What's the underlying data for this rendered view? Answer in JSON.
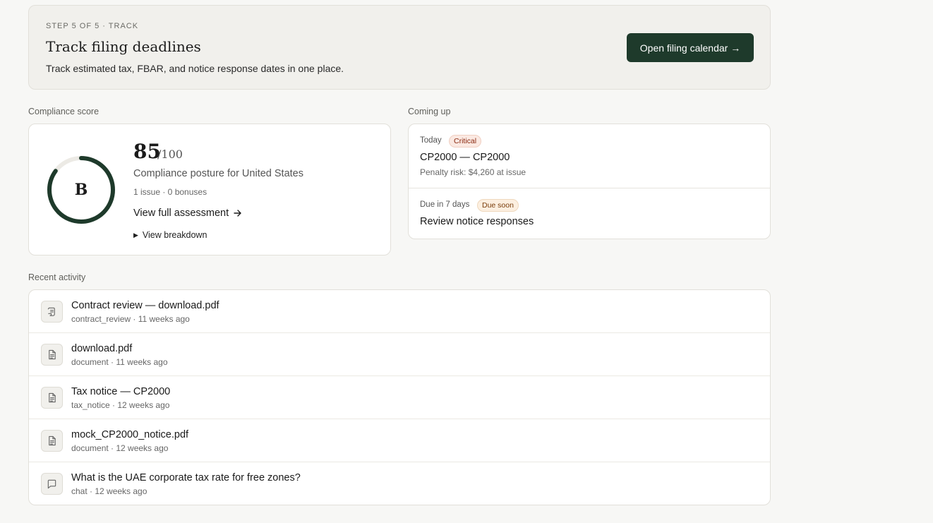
{
  "hero": {
    "step": "STEP 5 OF 5 · TRACK",
    "title": "Track filing deadlines",
    "description": "Track estimated tax, FBAR, and notice response dates in one place.",
    "cta_label": "Open filing calendar →"
  },
  "compliance": {
    "section_label": "Compliance score",
    "grade": "B",
    "score": "85",
    "score_max": "/100",
    "score_fraction": 0.85,
    "posture": "Compliance posture for United States",
    "issues": "1 issue · 0 bonuses",
    "assessment_link": "View full assessment",
    "breakdown_label": "View breakdown"
  },
  "coming_up": {
    "section_label": "Coming up",
    "items": [
      {
        "when": "Today",
        "badge": "Critical",
        "title": "CP2000 — CP2000",
        "subtitle": "Penalty risk: $4,260 at issue"
      },
      {
        "when": "Due in 7 days",
        "badge": "Due soon",
        "title": "Review notice responses"
      }
    ]
  },
  "activity": {
    "section_label": "Recent activity",
    "items": [
      {
        "title": "Contract review — download.pdf",
        "meta": "contract_review · 11 weeks ago",
        "icon": "contract-icon"
      },
      {
        "title": "download.pdf",
        "meta": "document · 11 weeks ago",
        "icon": "document-icon"
      },
      {
        "title": "Tax notice — CP2000",
        "meta": "tax_notice · 12 weeks ago",
        "icon": "document-icon"
      },
      {
        "title": "mock_CP2000_notice.pdf",
        "meta": "document · 12 weeks ago",
        "icon": "document-icon"
      },
      {
        "title": "What is the UAE corporate tax rate for free zones?",
        "meta": "chat · 12 weeks ago",
        "icon": "chat-icon"
      }
    ]
  },
  "colors": {
    "accent": "#1e3a2b",
    "critical": "#8a2a12",
    "due_soon": "#7a3e0c"
  }
}
